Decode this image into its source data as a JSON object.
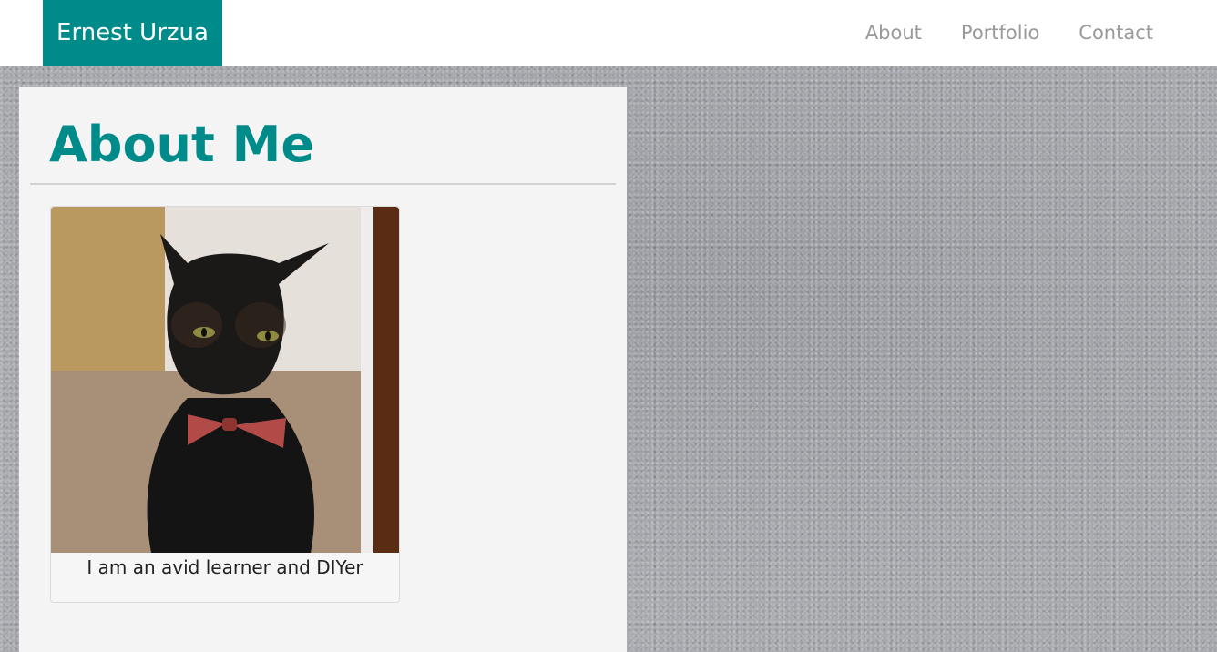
{
  "navbar": {
    "brand": "Ernest Urzua",
    "links": [
      "About",
      "Portfolio",
      "Contact"
    ]
  },
  "main": {
    "title": "About Me",
    "card": {
      "image_alt": "black cat wearing a plaid bow tie",
      "caption": "I am an avid learner and DIYer"
    }
  },
  "colors": {
    "accent": "#008b8b",
    "nav_link": "#9a9a9a",
    "panel": "#f4f4f4"
  }
}
